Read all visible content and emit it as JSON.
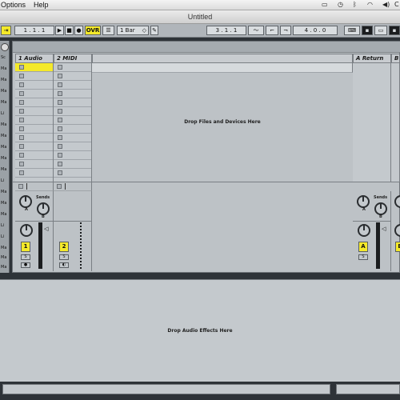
{
  "menubar": {
    "menus": [
      "Options",
      "Help"
    ],
    "tray_icons": [
      "airplay-icon",
      "time-machine-icon",
      "bluetooth-icon",
      "wifi-icon",
      "volume-icon"
    ],
    "clock_fragment": "C"
  },
  "window": {
    "title": "Untitled"
  },
  "controlbar": {
    "arrangement_position": "1 .  1 .  1",
    "ovr_label": "OVR",
    "quantize": "1 Bar",
    "loop_start": "3 .  1 .  1",
    "loop_length": "4 .  0 .  0"
  },
  "tracks": [
    {
      "name": "1 Audio",
      "number": "1"
    },
    {
      "name": "2 MIDI",
      "number": "2"
    },
    {
      "name": "A Return",
      "number": "A"
    },
    {
      "name": "B R",
      "number": "B"
    }
  ],
  "left_panel_labels": [
    "Sc",
    "Ma",
    "Ma",
    "Ma",
    "Ma",
    "Li",
    "Ma",
    "Ma",
    "Ma",
    "Ma",
    "Ma",
    "Li",
    "Ma",
    "Ma",
    "Ma",
    "Li",
    "Li",
    "Ma",
    "Ma",
    "Ma"
  ],
  "session": {
    "drop_hint": "Drop Files and Devices Here",
    "sends_label": "Sends",
    "send_a": "A",
    "send_b": "B",
    "solo_label": "S"
  },
  "device_view": {
    "drop_hint": "Drop Audio Effects Here"
  },
  "colors": {
    "accent_yellow": "#f4e92a",
    "panel_grey": "#c4c9cd",
    "frame_dark": "#2e3338"
  }
}
